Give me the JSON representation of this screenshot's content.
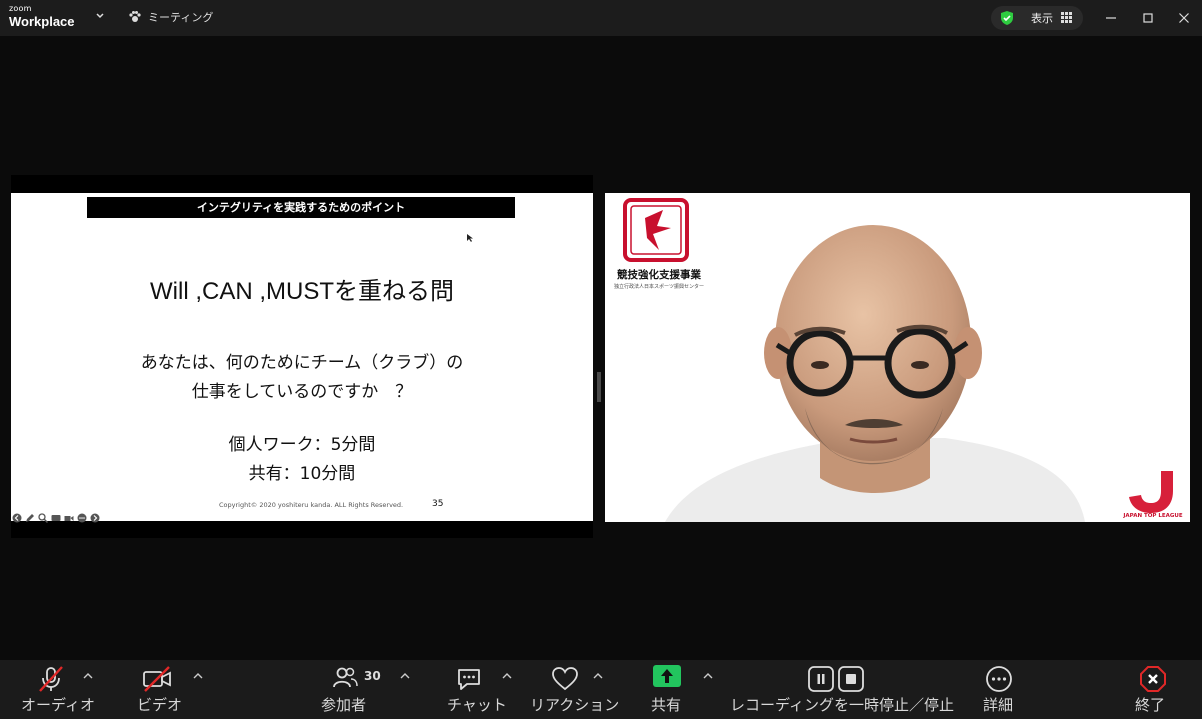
{
  "app": {
    "brand_small": "zoom",
    "brand_large": "Workplace"
  },
  "titlebar": {
    "meeting_label": "ミーティング",
    "view_label": "表示"
  },
  "slide": {
    "header": "インテグリティを実践するためのポイント",
    "title": "Will ,CAN ,MUSTを重ねる問",
    "question_line1": "あなたは、何のためにチーム（クラブ）の",
    "question_line2": "仕事をしているのですか　？",
    "work_line1": "個人ワーク：5分間",
    "work_line2": "共有：10分間",
    "copyright": "Copyright© 2020 yoshiteru kanda. ALL Rights Reserved.",
    "page_number": "35"
  },
  "video": {
    "org_name": "競技強化支援事業",
    "org_subtitle": "独立行政法人日本スポーツ振興センター",
    "league_label": "JAPAN TOP LEAGUE"
  },
  "toolbar": {
    "audio_label": "オーディオ",
    "video_label": "ビデオ",
    "participants_label": "参加者",
    "participants_count": "30",
    "chat_label": "チャット",
    "reaction_label": "リアクション",
    "share_label": "共有",
    "recording_label": "レコーディングを一時停止／停止",
    "more_label": "詳細",
    "end_label": "終了"
  },
  "colors": {
    "share_green": "#22c55e",
    "end_red": "#e02828",
    "shield_green": "#2ecc40",
    "brand_red": "#c8102e"
  }
}
